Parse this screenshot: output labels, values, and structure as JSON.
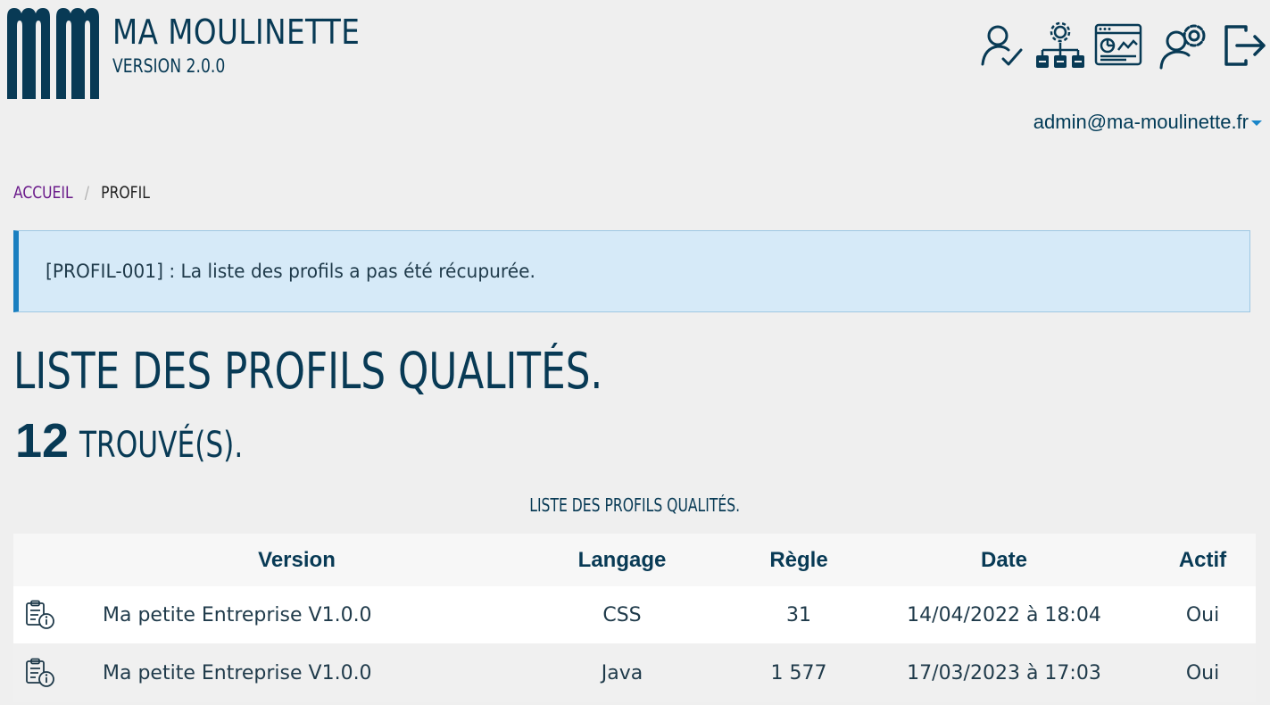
{
  "header": {
    "logo_icon": "mm-logo",
    "app_name": "MA MOULINETTE",
    "version": "VERSION 2.0.0",
    "icons": [
      "user-check-icon",
      "org-settings-icon",
      "dashboard-chart-icon",
      "user-settings-icon",
      "logout-icon"
    ],
    "user_email": "admin@ma-moulinette.fr"
  },
  "breadcrumb": {
    "home": "ACCUEIL",
    "separator": "/",
    "current": "PROFIL"
  },
  "alert": {
    "message": "[PROFIL-001] : La liste des profils a pas été récupurée."
  },
  "page": {
    "title": "LISTE DES PROFILS QUALITÉS.",
    "count": "12",
    "count_label": "TROUVÉ(S)."
  },
  "table": {
    "caption": "LISTE DES PROFILS QUALITÉS.",
    "columns": [
      "",
      "Version",
      "Langage",
      "Règle",
      "Date",
      "Actif"
    ],
    "rows": [
      {
        "icon": "clipboard-info-icon",
        "version": "Ma petite Entreprise V1.0.0",
        "langage": "CSS",
        "regle": "31",
        "date": "14/04/2022 à 18:04",
        "actif": "Oui"
      },
      {
        "icon": "clipboard-info-icon",
        "version": "Ma petite Entreprise V1.0.0",
        "langage": "Java",
        "regle": "1 577",
        "date": "17/03/2023 à 17:03",
        "actif": "Oui"
      }
    ]
  },
  "colors": {
    "primary": "#083a55",
    "link": "#6a1a8a",
    "alert_bg": "#d6eaf8",
    "alert_border": "#1a7fc0"
  }
}
